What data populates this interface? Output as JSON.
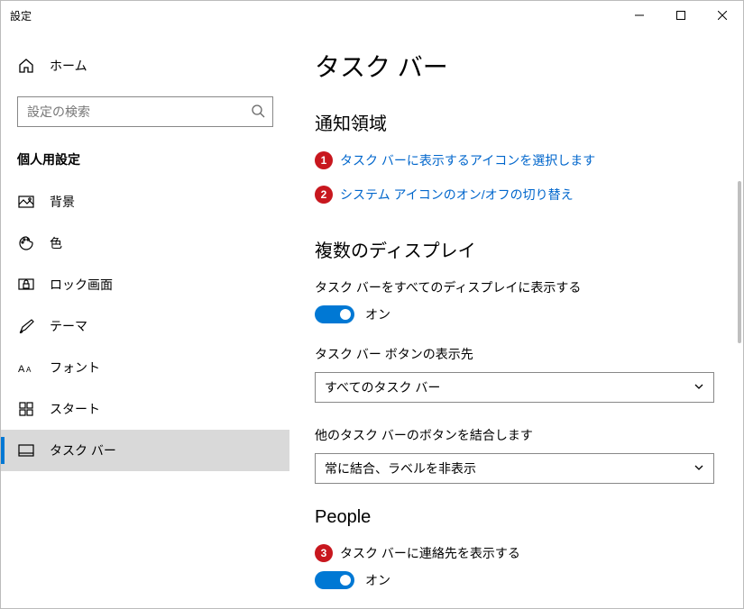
{
  "window": {
    "title": "設定"
  },
  "home": {
    "label": "ホーム"
  },
  "search": {
    "placeholder": "設定の検索"
  },
  "section_header": "個人用設定",
  "nav": [
    {
      "id": "background",
      "label": "背景"
    },
    {
      "id": "colors",
      "label": "色"
    },
    {
      "id": "lockscreen",
      "label": "ロック画面"
    },
    {
      "id": "themes",
      "label": "テーマ"
    },
    {
      "id": "fonts",
      "label": "フォント"
    },
    {
      "id": "start",
      "label": "スタート"
    },
    {
      "id": "taskbar",
      "label": "タスク バー"
    }
  ],
  "page": {
    "title": "タスク バー",
    "notif_header": "通知領域",
    "links": {
      "select_icons": "タスク バーに表示するアイコンを選択します",
      "system_icons": "システム アイコンのオン/オフの切り替え"
    },
    "multi_header": "複数のディスプレイ",
    "multi": {
      "show_all_label": "タスク バーをすべてのディスプレイに表示する",
      "show_all_state": "オン",
      "button_dest_label": "タスク バー ボタンの表示先",
      "button_dest_value": "すべてのタスク バー",
      "combine_label": "他のタスク バーのボタンを結合します",
      "combine_value": "常に結合、ラベルを非表示"
    },
    "people_header": "People",
    "people": {
      "show_contacts_label": "タスク バーに連絡先を表示する",
      "show_contacts_state": "オン"
    }
  },
  "annotations": {
    "a1": "1",
    "a2": "2",
    "a3": "3"
  }
}
